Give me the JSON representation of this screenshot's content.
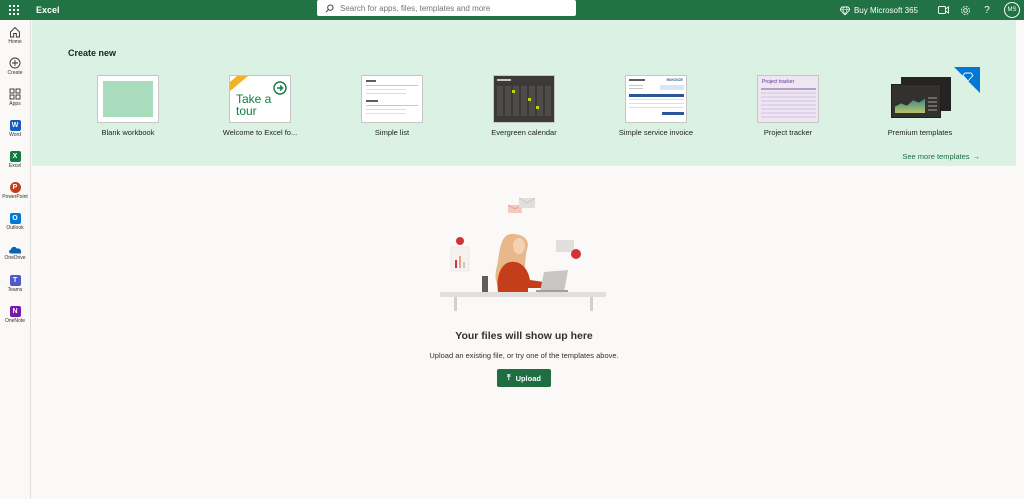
{
  "header": {
    "app_title": "Excel",
    "search_placeholder": "Search for apps, files, templates and more",
    "buy_label": "Buy Microsoft 365",
    "help_label": "?",
    "avatar_initials": "MS"
  },
  "rail": {
    "items": [
      {
        "label": "Home",
        "icon": "home-icon"
      },
      {
        "label": "Create",
        "icon": "plus-circle-icon"
      },
      {
        "label": "Apps",
        "icon": "apps-icon"
      },
      {
        "label": "Word",
        "icon": "word-icon",
        "letter": "W",
        "color": "#185abd"
      },
      {
        "label": "Excel",
        "icon": "excel-icon",
        "letter": "X",
        "color": "#107c41"
      },
      {
        "label": "PowerPoint",
        "icon": "powerpoint-icon",
        "letter": "P",
        "color": "#c43e1c"
      },
      {
        "label": "Outlook",
        "icon": "outlook-icon",
        "letter": "O",
        "color": "#0078d4"
      },
      {
        "label": "OneDrive",
        "icon": "onedrive-icon"
      },
      {
        "label": "Teams",
        "icon": "teams-icon",
        "letter": "T",
        "color": "#5059c9"
      },
      {
        "label": "OneNote",
        "icon": "onenote-icon",
        "letter": "N",
        "color": "#7719aa"
      }
    ]
  },
  "create": {
    "title": "Create new",
    "see_more": "See more templates",
    "templates": [
      {
        "label": "Blank workbook"
      },
      {
        "label": "Welcome to Excel fo...",
        "thumb_text": "Take a tour"
      },
      {
        "label": "Simple list"
      },
      {
        "label": "Evergreen calendar"
      },
      {
        "label": "Simple service invoice",
        "thumb_text": "INVOICE"
      },
      {
        "label": "Project tracker",
        "thumb_text": "Project tracker"
      },
      {
        "label": "Premium templates"
      }
    ]
  },
  "empty_state": {
    "title": "Your files will show up here",
    "subtitle": "Upload an existing file, or try one of the templates above.",
    "upload_label": "Upload"
  },
  "colors": {
    "brand": "#217346",
    "band": "#dbf1e4",
    "button": "#1e6e42"
  }
}
